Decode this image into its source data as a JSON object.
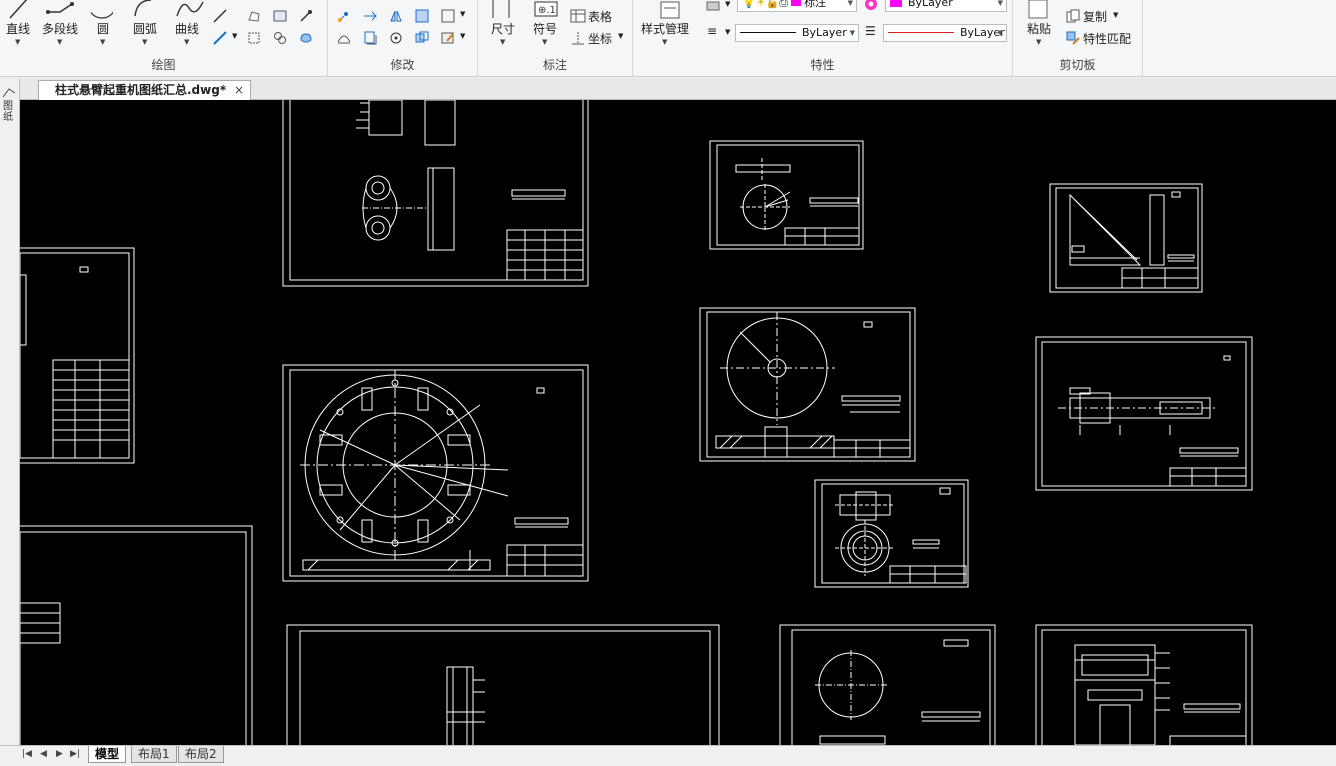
{
  "ribbon": {
    "draw": {
      "title": "绘图",
      "line": "直线",
      "polyline": "多段线",
      "circle": "圆",
      "arc": "圆弧",
      "curve": "曲线"
    },
    "modify": {
      "title": "修改"
    },
    "annotate": {
      "title": "标注",
      "dimension": "尺寸",
      "symbol": "符号",
      "table": "表格",
      "coordinate": "坐标"
    },
    "properties": {
      "title": "特性",
      "style_manager": "样式管理",
      "layer_name": "标注",
      "color_value": "ByLayer",
      "linetype_value": "ByLayer",
      "lineweight_value": "ByLayer"
    },
    "clipboard": {
      "title": "剪切板",
      "paste": "粘贴",
      "copy": "复制",
      "match_properties": "特性匹配"
    }
  },
  "tabs": {
    "document": "柱式悬臂起重机图纸汇总.dwg*",
    "close": "×"
  },
  "left_strip": {
    "label": "图纸"
  },
  "layout_tabs": [
    "模型",
    "布局1",
    "布局2"
  ],
  "colors": {
    "canvas_bg": "#000000",
    "drawing_line": "#ffffff",
    "magenta": "#ff00ff",
    "red_line": "#e02020"
  }
}
